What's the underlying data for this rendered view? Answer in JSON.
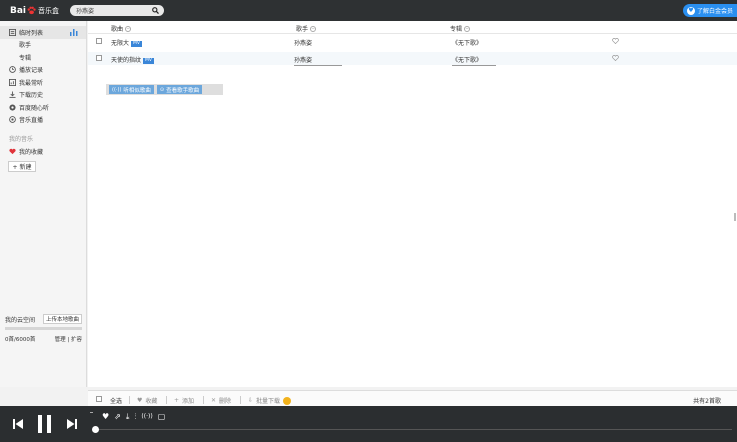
{
  "header": {
    "logo_text": "Bai",
    "logo_paw": "du",
    "logo_suffix": "音乐盒",
    "search_value": "孙燕姿",
    "promo_label": "了解白金会员"
  },
  "sidebar": {
    "items": [
      {
        "label": "临时列表",
        "icon": "list-icon",
        "active": true
      },
      {
        "label": "歌手",
        "sub": true
      },
      {
        "label": "专辑",
        "sub": true
      },
      {
        "label": "播放记录",
        "icon": "clock-icon"
      },
      {
        "label": "我最常听",
        "icon": "chart-icon"
      },
      {
        "label": "下载历史",
        "icon": "download-icon"
      },
      {
        "label": "百度随心听",
        "icon": "radio-icon"
      },
      {
        "label": "音乐直播",
        "icon": "live-icon"
      }
    ],
    "section_label": "我的音乐",
    "favorites_label": "我的收藏",
    "new_button": "+ 新建",
    "cloud_label": "我的云空间",
    "upload_label": "上传本地歌曲",
    "cloud_usage": "0首/6000首",
    "manage_label": "管理",
    "expand_label": "扩容"
  },
  "table": {
    "columns": [
      "歌曲",
      "歌手",
      "专辑"
    ],
    "rows": [
      {
        "song": "无限大",
        "tag": "MV",
        "artist": "孙燕姿",
        "album": "《无下歌》"
      },
      {
        "song": "天使的指纹",
        "tag": "MV",
        "artist": "孙燕姿",
        "album": "《无下歌》"
      }
    ]
  },
  "actions": {
    "listen_label": "听相似歌曲",
    "view_label": "查看歌手歌曲"
  },
  "footer": {
    "select_all": "全选",
    "favorite": "收藏",
    "add": "添加",
    "delete": "删除",
    "batch_download": "批量下载",
    "count": "共有2首歌"
  },
  "colors": {
    "topbar": "#2e3133",
    "accent": "#2a8ff0",
    "action_button": "#6ca7dc",
    "player": "#2b2e30"
  }
}
